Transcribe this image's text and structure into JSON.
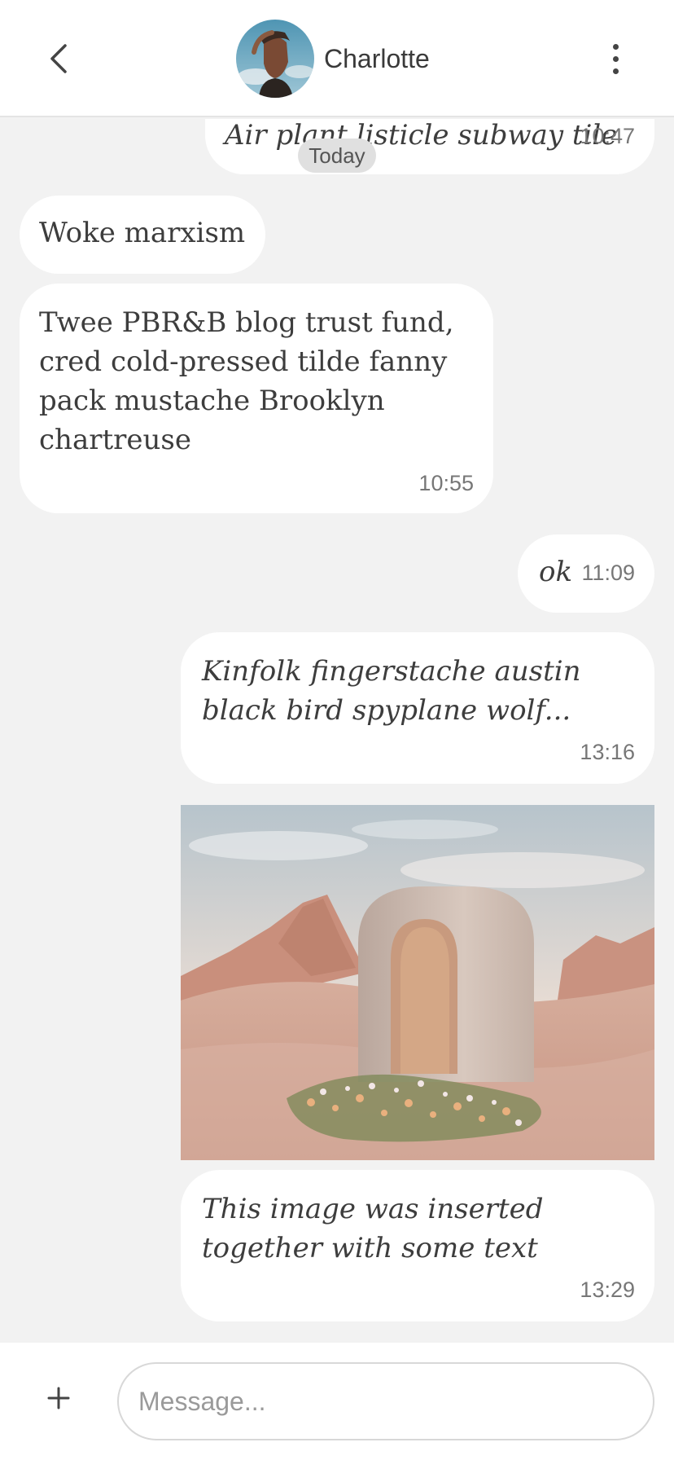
{
  "header": {
    "contact_name": "Charlotte",
    "back_icon": "chevron-left-icon",
    "more_icon": "more-vertical-icon"
  },
  "chat": {
    "day_separator": "Today",
    "messages": [
      {
        "side": "outgoing",
        "text": "Air plant listicle subway tile",
        "time": "10:47",
        "italic": true
      },
      {
        "side": "incoming",
        "text": "Woke marxism",
        "time": ""
      },
      {
        "side": "incoming",
        "text": "Twee PBR&B blog trust fund, cred cold-pressed tilde fanny pack mustache Brooklyn chartreuse",
        "time": "10:55"
      },
      {
        "side": "outgoing",
        "text": "ok",
        "time": "11:09",
        "italic": true
      },
      {
        "side": "outgoing",
        "text": "Kinfolk fingerstache austin black bird spyplane wolf...",
        "time": "13:16",
        "italic": true
      },
      {
        "side": "outgoing",
        "type": "image",
        "image": "desert-arch-photo"
      },
      {
        "side": "outgoing",
        "text": "This image was inserted together with some text",
        "time": "13:29",
        "italic": true
      }
    ]
  },
  "composer": {
    "placeholder": "Message...",
    "add_icon": "plus-icon"
  },
  "colors": {
    "background": "#f2f2f2",
    "bubble": "#ffffff",
    "header": "#ffffff"
  }
}
